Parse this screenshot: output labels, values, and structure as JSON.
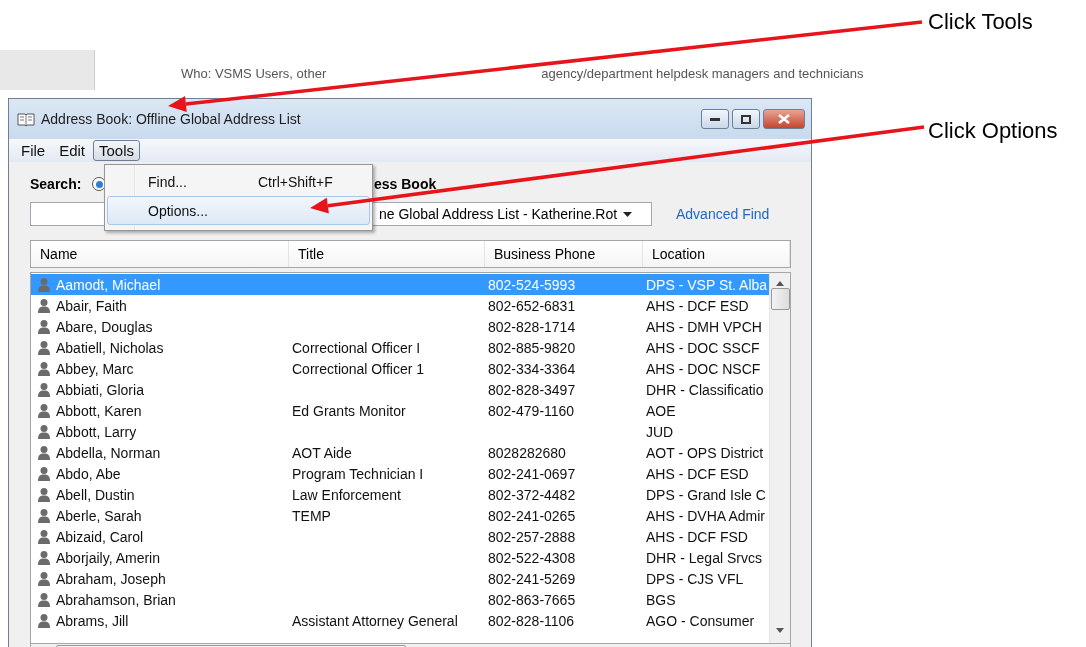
{
  "background_document": {
    "texts": [
      "Who:     VSMS Users, other",
      "agency/department helpdesk managers and technicians"
    ]
  },
  "annotations": [
    {
      "label": "Click Tools"
    },
    {
      "label": "Click Options"
    }
  ],
  "window": {
    "title": "Address Book: Offline Global Address List"
  },
  "menu_bar": [
    {
      "label": "File",
      "selected": false
    },
    {
      "label": "Edit",
      "selected": false
    },
    {
      "label": "Tools",
      "selected": true
    }
  ],
  "open_menu": {
    "items": [
      {
        "label": "Find...",
        "shortcut": "Ctrl+Shift+F",
        "selected": false
      },
      {
        "label": "Options...",
        "selected": true
      }
    ]
  },
  "search": {
    "label": "Search:",
    "radio_checked": true,
    "address_book_label": "ess Book",
    "address_book_value": "ne Global Address List - Katherine.Rot",
    "advanced_find": "Advanced Find"
  },
  "table": {
    "columns": [
      "Name",
      "Title",
      "Business Phone",
      "Location"
    ],
    "rows": [
      {
        "name": "Aamodt, Michael",
        "title": "",
        "phone": "802-524-5993",
        "location": "DPS - VSP St. Alba",
        "selected": true
      },
      {
        "name": "Abair, Faith",
        "title": "",
        "phone": "802-652-6831",
        "location": "AHS - DCF ESD",
        "selected": false
      },
      {
        "name": "Abare, Douglas",
        "title": "",
        "phone": "802-828-1714",
        "location": "AHS - DMH VPCH",
        "selected": false
      },
      {
        "name": "Abatiell, Nicholas",
        "title": "Correctional Officer I",
        "phone": "802-885-9820",
        "location": "AHS - DOC SSCF",
        "selected": false
      },
      {
        "name": "Abbey, Marc",
        "title": "Correctional Officer 1",
        "phone": "802-334-3364",
        "location": "AHS - DOC NSCF",
        "selected": false
      },
      {
        "name": "Abbiati, Gloria",
        "title": "",
        "phone": "802-828-3497",
        "location": "DHR - Classificatio",
        "selected": false
      },
      {
        "name": "Abbott, Karen",
        "title": "Ed Grants Monitor",
        "phone": "802-479-1160",
        "location": "AOE",
        "selected": false
      },
      {
        "name": "Abbott, Larry",
        "title": "",
        "phone": "",
        "location": "JUD",
        "selected": false
      },
      {
        "name": "Abdella, Norman",
        "title": "AOT Aide",
        "phone": "8028282680",
        "location": "AOT - OPS District",
        "selected": false
      },
      {
        "name": "Abdo, Abe",
        "title": "Program Technician I",
        "phone": "802-241-0697",
        "location": "AHS - DCF ESD",
        "selected": false
      },
      {
        "name": "Abell, Dustin",
        "title": "Law Enforcement",
        "phone": "802-372-4482",
        "location": "DPS - Grand Isle C",
        "selected": false
      },
      {
        "name": "Aberle, Sarah",
        "title": "TEMP",
        "phone": "802-241-0265",
        "location": "AHS - DVHA Admir",
        "selected": false
      },
      {
        "name": "Abizaid, Carol",
        "title": "",
        "phone": "802-257-2888",
        "location": "AHS - DCF FSD",
        "selected": false
      },
      {
        "name": "Aborjaily, Amerin",
        "title": "",
        "phone": "802-522-4308",
        "location": "DHR - Legal Srvcs",
        "selected": false
      },
      {
        "name": "Abraham, Joseph",
        "title": "",
        "phone": "802-241-5269",
        "location": "DPS - CJS VFL",
        "selected": false
      },
      {
        "name": "Abrahamson, Brian",
        "title": "",
        "phone": "802-863-7665",
        "location": "BGS",
        "selected": false
      },
      {
        "name": "Abrams, Jill",
        "title": "Assistant Attorney General",
        "phone": "802-828-1106",
        "location": "AGO - Consumer",
        "selected": false
      }
    ]
  }
}
